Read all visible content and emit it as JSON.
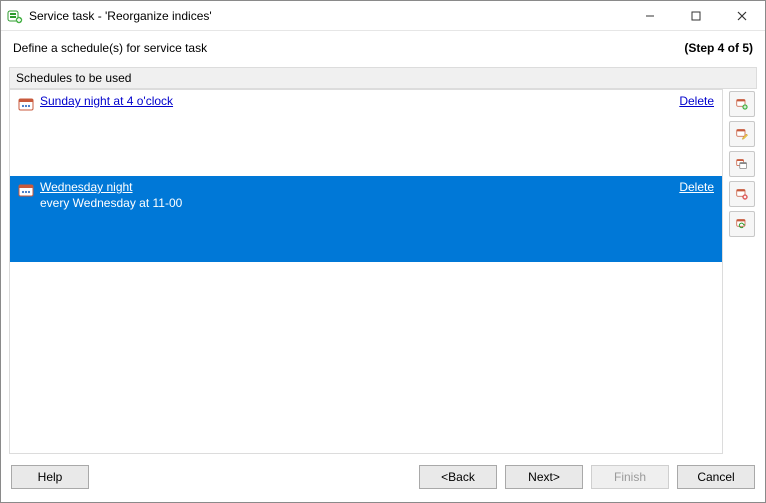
{
  "window": {
    "title": "Service task - 'Reorganize indices'"
  },
  "header": {
    "instruction": "Define a schedule(s) for service task",
    "step": "(Step 4 of 5)"
  },
  "panel": {
    "label": "Schedules to be used"
  },
  "schedules": [
    {
      "name": "Sunday night at 4 o'clock",
      "description": "",
      "delete_label": "Delete",
      "selected": false
    },
    {
      "name": "Wednesday night",
      "description": "every Wednesday at 11-00",
      "delete_label": "Delete",
      "selected": true
    }
  ],
  "side_buttons": [
    {
      "name": "add-schedule-icon"
    },
    {
      "name": "edit-schedule-icon"
    },
    {
      "name": "copy-schedule-icon"
    },
    {
      "name": "delete-schedule-icon"
    },
    {
      "name": "reload-schedule-icon"
    }
  ],
  "footer": {
    "help": "Help",
    "back": "<Back",
    "next": "Next>",
    "finish": "Finish",
    "cancel": "Cancel"
  }
}
